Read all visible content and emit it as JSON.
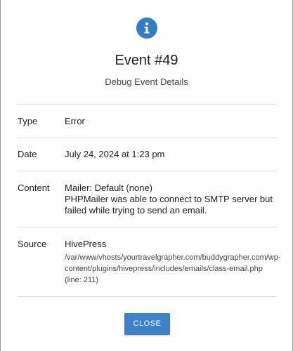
{
  "dialog": {
    "icon": "info-icon",
    "title": "Event #49",
    "subtitle": "Debug Event Details"
  },
  "fields": {
    "type": {
      "label": "Type",
      "value": "Error"
    },
    "date": {
      "label": "Date",
      "value": "July 24, 2024 at 1:23 pm"
    },
    "content": {
      "label": "Content",
      "lines": [
        "Mailer: Default (none)",
        "PHPMailer was able to connect to SMTP server but",
        "failed while trying to send an email."
      ]
    },
    "source": {
      "label": "Source",
      "value": "HivePress",
      "path_lines": [
        "/var/www/vhosts/yourtravelgrapher.com/buddygrapher.com/wp-",
        "content/plugins/hivepress/includes/emails/class-email.php",
        "(line: 211)"
      ]
    }
  },
  "actions": {
    "close_label": "CLOSE"
  },
  "colors": {
    "accent": "#3b82c9",
    "icon_bg": "#2f7ec8"
  }
}
